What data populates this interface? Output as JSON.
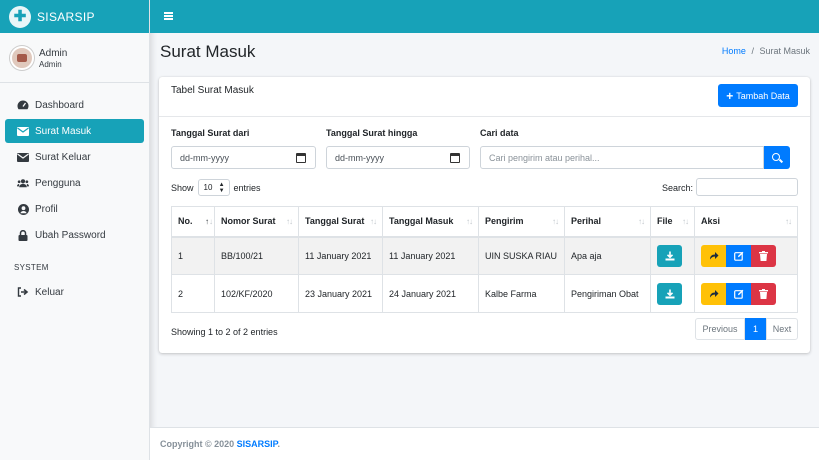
{
  "app": {
    "brand": "SISARSIP"
  },
  "user": {
    "name": "Admin",
    "role": "Admin"
  },
  "sidebar": {
    "items": [
      {
        "label": "Dashboard",
        "icon": "tachometer-icon"
      },
      {
        "label": "Surat Masuk",
        "icon": "envelope-icon",
        "active": true
      },
      {
        "label": "Surat Keluar",
        "icon": "envelope-icon"
      },
      {
        "label": "Pengguna",
        "icon": "users-icon"
      },
      {
        "label": "Profil",
        "icon": "user-circle-icon"
      },
      {
        "label": "Ubah Password",
        "icon": "lock-icon"
      }
    ],
    "section_header": "SYSTEM",
    "logout": {
      "label": "Keluar",
      "icon": "sign-out-icon"
    }
  },
  "page": {
    "title": "Surat Masuk",
    "breadcrumb": {
      "home": "Home",
      "separator": "/",
      "current": "Surat Masuk"
    }
  },
  "card": {
    "title": "Tabel Surat Masuk",
    "add_button": "Tambah Data"
  },
  "filters": {
    "date_from_label": "Tanggal Surat dari",
    "date_from_value": "dd-mm-yyyy",
    "date_to_label": "Tanggal Surat hingga",
    "date_to_value": "dd-mm-yyyy",
    "search_label": "Cari data",
    "search_placeholder": "Cari pengirim atau perihal..."
  },
  "datatable": {
    "show_label": "Show",
    "entries_label": "entries",
    "length_value": "10",
    "search_label": "Search:",
    "columns": [
      "No.",
      "Nomor Surat",
      "Tanggal Surat",
      "Tanggal Masuk",
      "Pengirim",
      "Perihal",
      "File",
      "Aksi"
    ],
    "rows": [
      {
        "no": "1",
        "nomor": "BB/100/21",
        "tgl_surat": "11 January 2021",
        "tgl_masuk": "11 January 2021",
        "pengirim": "UIN SUSKA RIAU",
        "perihal": "Apa aja"
      },
      {
        "no": "2",
        "nomor": "102/KF/2020",
        "tgl_surat": "23 January 2021",
        "tgl_masuk": "24 January 2021",
        "pengirim": "Kalbe Farma",
        "perihal": "Pengiriman Obat"
      }
    ],
    "info": "Showing 1 to 2 of 2 entries",
    "pagination": {
      "previous": "Previous",
      "current": "1",
      "next": "Next"
    }
  },
  "footer": {
    "prefix": "Copyright © 2020 ",
    "brand": "SISARSIP",
    "suffix": "."
  },
  "colors": {
    "primary": "#007bff",
    "info": "#17a2b8",
    "warning": "#ffc107",
    "danger": "#dc3545"
  }
}
